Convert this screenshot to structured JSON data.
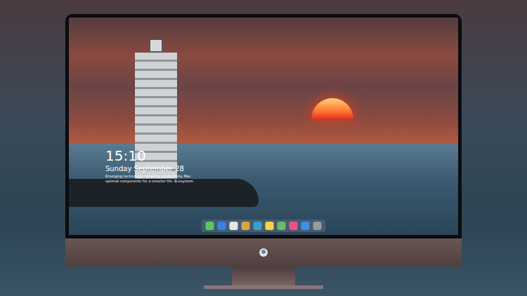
{
  "lock_screen": {
    "time": "15:10",
    "date": "Sunday September 28",
    "caption": "Emerging technology, amazing productivity. Mac optimal components for a smarter life. Ecosystem"
  },
  "dock": {
    "items": [
      {
        "color": "#5ac85a"
      },
      {
        "color": "#3b82e0"
      },
      {
        "color": "#e6e6e6"
      },
      {
        "color": "#d9a441"
      },
      {
        "color": "#3aa0c8"
      },
      {
        "color": "#f5d547"
      },
      {
        "color": "#6cb86c"
      },
      {
        "color": "#f0508a"
      },
      {
        "color": "#3d8ee8"
      },
      {
        "color": "#9a9a9a"
      }
    ]
  }
}
